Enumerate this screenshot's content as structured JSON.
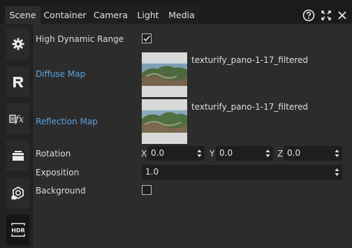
{
  "tabs": [
    {
      "label": "Scene",
      "active": true
    },
    {
      "label": "Container",
      "active": false
    },
    {
      "label": "Camera",
      "active": false
    },
    {
      "label": "Light",
      "active": false
    },
    {
      "label": "Media",
      "active": false
    }
  ],
  "window_controls": {
    "help": "help-icon",
    "expand": "expand-icon",
    "close": "close-icon"
  },
  "sidebar": [
    "gear-icon",
    "r-logo-icon",
    "fx-icon",
    "container-icon",
    "camera-box-icon",
    "hdr-icon"
  ],
  "properties": {
    "hdr": {
      "label": "High Dynamic Range",
      "checked": true
    },
    "diffuse": {
      "label": "Diffuse Map",
      "file": "texturify_pano-1-17_filtered"
    },
    "reflection": {
      "label": "Reflection Map",
      "file": "texturify_pano-1-17_filtered"
    },
    "rotation": {
      "label": "Rotation",
      "x_label": "X",
      "x": "0.0",
      "y_label": "Y",
      "y": "0.0",
      "z_label": "Z",
      "z": "0.0"
    },
    "exposition": {
      "label": "Exposition",
      "value": "1.0"
    },
    "background": {
      "label": "Background",
      "checked": false
    }
  },
  "colors": {
    "accent_link": "#5ba3e0",
    "panel": "#2c2c2c",
    "tabbar": "#1b1b1b"
  }
}
